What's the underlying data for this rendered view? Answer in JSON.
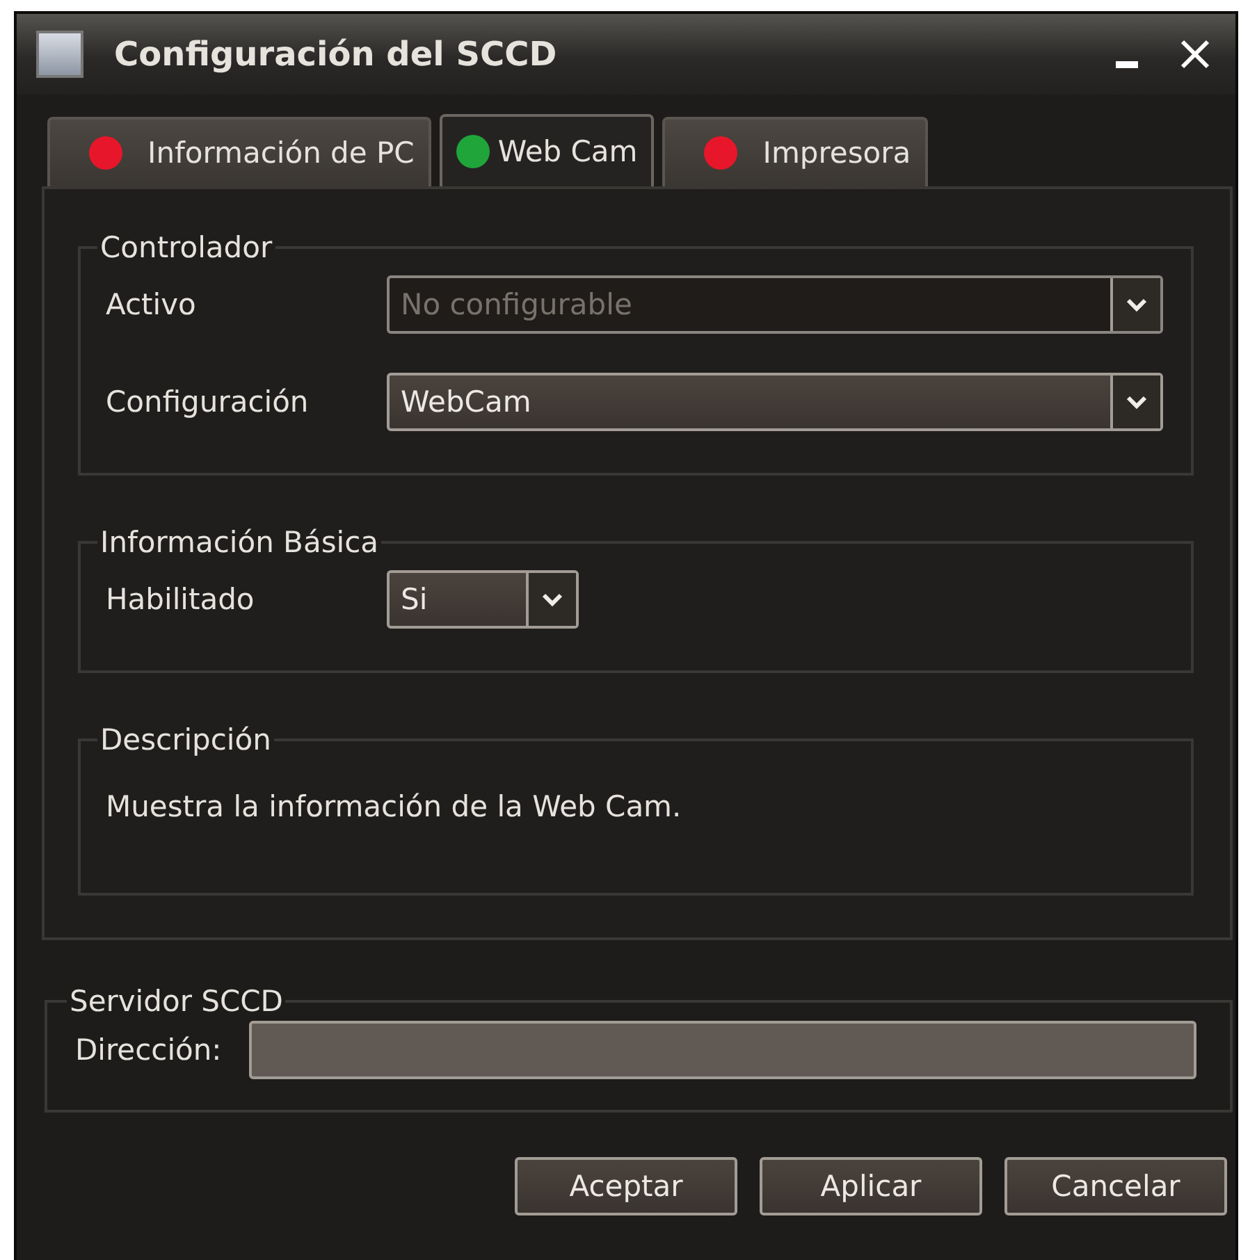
{
  "window": {
    "title": "Configuración del SCCD"
  },
  "tabs": [
    {
      "label": "Información de PC",
      "selected": false,
      "color": "#e8162a"
    },
    {
      "label": "Web Cam",
      "selected": true,
      "color": "#1fa53a"
    },
    {
      "label": "Impresora",
      "selected": false,
      "color": "#e8162a"
    }
  ],
  "groups": [
    {
      "title": "Controlador",
      "rows": [
        {
          "label": "Activo",
          "kind": "combo",
          "value": "No configurable",
          "disabled": true,
          "wide": true
        },
        {
          "label": "Configuración",
          "kind": "combo",
          "value": "WebCam",
          "disabled": false,
          "wide": true
        }
      ]
    },
    {
      "title": "Información Básica",
      "rows": [
        {
          "label": "Habilitado",
          "kind": "combo",
          "value": "Si",
          "disabled": false,
          "wide": false
        }
      ]
    },
    {
      "title": "Descripción",
      "rows": [
        {
          "kind": "text",
          "value": "Muestra la información de la Web Cam."
        }
      ]
    }
  ],
  "server": {
    "title": "Servidor SCCD",
    "label": "Dirección:"
  },
  "buttons": [
    "Aceptar",
    "Aplicar",
    "Cancelar"
  ]
}
